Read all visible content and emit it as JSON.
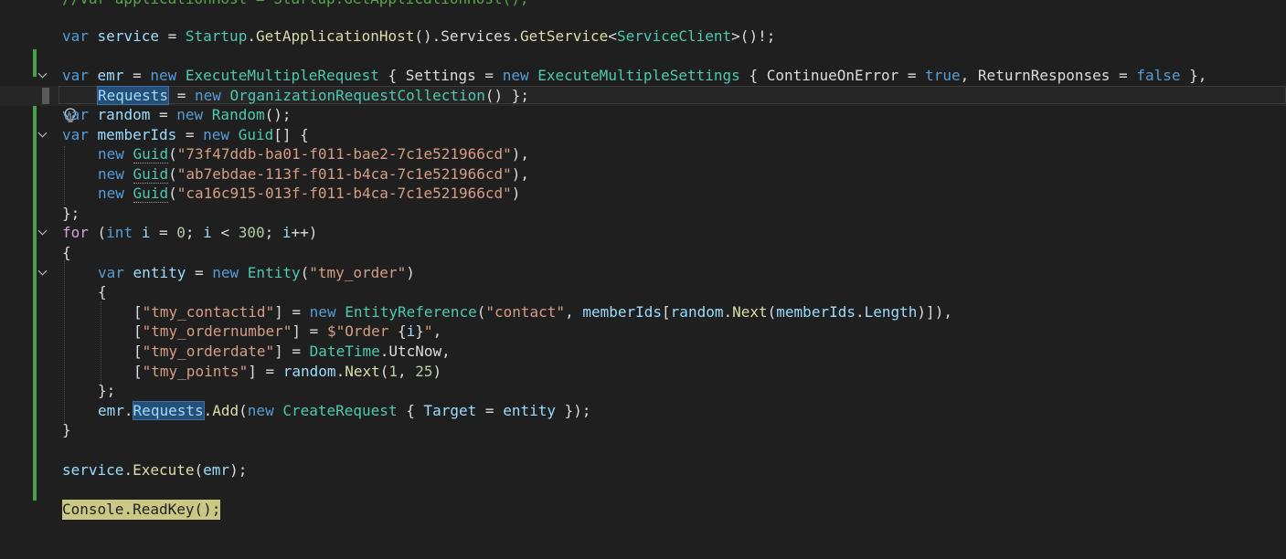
{
  "lines": {
    "l0": "//var applicationHost = Startup.GetApplicationHost();",
    "l1": [
      "var",
      " ",
      "service",
      " = ",
      "Startup",
      ".",
      "GetApplicationHost",
      "().",
      "Services",
      ".",
      "GetService",
      "<",
      "ServiceClient",
      ">()!;"
    ],
    "l3": [
      "var",
      " ",
      "emr",
      " = ",
      "new",
      " ",
      "ExecuteMultipleRequest",
      " { ",
      "Settings",
      " = ",
      "new",
      " ",
      "ExecuteMultipleSettings",
      " { ",
      "ContinueOnError",
      " = ",
      "true",
      ", ",
      "ReturnResponses",
      " = ",
      "false",
      " },"
    ],
    "l4": [
      "Requests",
      " = ",
      "new",
      " ",
      "OrganizationRequestCollection",
      "() };"
    ],
    "l5": [
      "var",
      " ",
      "random",
      " = ",
      "new",
      " ",
      "Random",
      "();"
    ],
    "l6": [
      "var",
      " ",
      "memberIds",
      " = ",
      "new",
      " ",
      "Guid",
      "[] {"
    ],
    "l7": [
      "new",
      " ",
      "Guid",
      "(",
      "\"73f47ddb-ba01-f011-bae2-7c1e521966cd\"",
      "),"
    ],
    "l8": [
      "new",
      " ",
      "Guid",
      "(",
      "\"ab7ebdae-113f-f011-b4ca-7c1e521966cd\"",
      "),"
    ],
    "l9": [
      "new",
      " ",
      "Guid",
      "(",
      "\"ca16c915-013f-f011-b4ca-7c1e521966cd\"",
      ")"
    ],
    "l10": "};",
    "l11": [
      "for",
      " (",
      "int",
      " ",
      "i",
      " = ",
      "0",
      "; ",
      "i",
      " < ",
      "300",
      "; ",
      "i",
      "++)"
    ],
    "l12": "{",
    "l13": [
      "var",
      " ",
      "entity",
      " = ",
      "new",
      " ",
      "Entity",
      "(",
      "\"tmy_order\"",
      ")"
    ],
    "l14": "{",
    "l15": [
      "[",
      "\"tmy_contactid\"",
      "] = ",
      "new",
      " ",
      "EntityReference",
      "(",
      "\"contact\"",
      ", ",
      "memberIds",
      "[",
      "random",
      ".",
      "Next",
      "(",
      "memberIds",
      ".",
      "Length",
      ")]),"
    ],
    "l16": [
      "[",
      "\"tmy_ordernumber\"",
      "] = ",
      "$\"Order ",
      "{",
      "i",
      "}",
      "\"",
      ","
    ],
    "l17": [
      "[",
      "\"tmy_orderdate\"",
      "] = ",
      "DateTime",
      ".",
      "UtcNow",
      ","
    ],
    "l18": [
      "[",
      "\"tmy_points\"",
      "] = ",
      "random",
      ".",
      "Next",
      "(",
      "1",
      ", ",
      "25",
      ")"
    ],
    "l19": "};",
    "l20": [
      "emr",
      ".",
      "Requests",
      ".",
      "Add",
      "(",
      "new",
      " ",
      "CreateRequest",
      " { ",
      "Target",
      " = ",
      "entity",
      " });"
    ],
    "l21": "}",
    "l23": [
      "service",
      ".",
      "Execute",
      "(",
      "emr",
      ");"
    ],
    "l25": "Console.ReadKey();"
  },
  "icons": {
    "lightbulb": "lightbulb-icon",
    "fold": "chevron-down-icon"
  },
  "colors": {
    "background": "#1f1f1f",
    "keyword": "#569cd6",
    "type": "#4ec9b0",
    "method": "#dcdcaa",
    "variable": "#9cdcfe",
    "string": "#d69d85",
    "number": "#b5cea8",
    "comment": "#57a64a",
    "change_bar": "#46a04c"
  }
}
